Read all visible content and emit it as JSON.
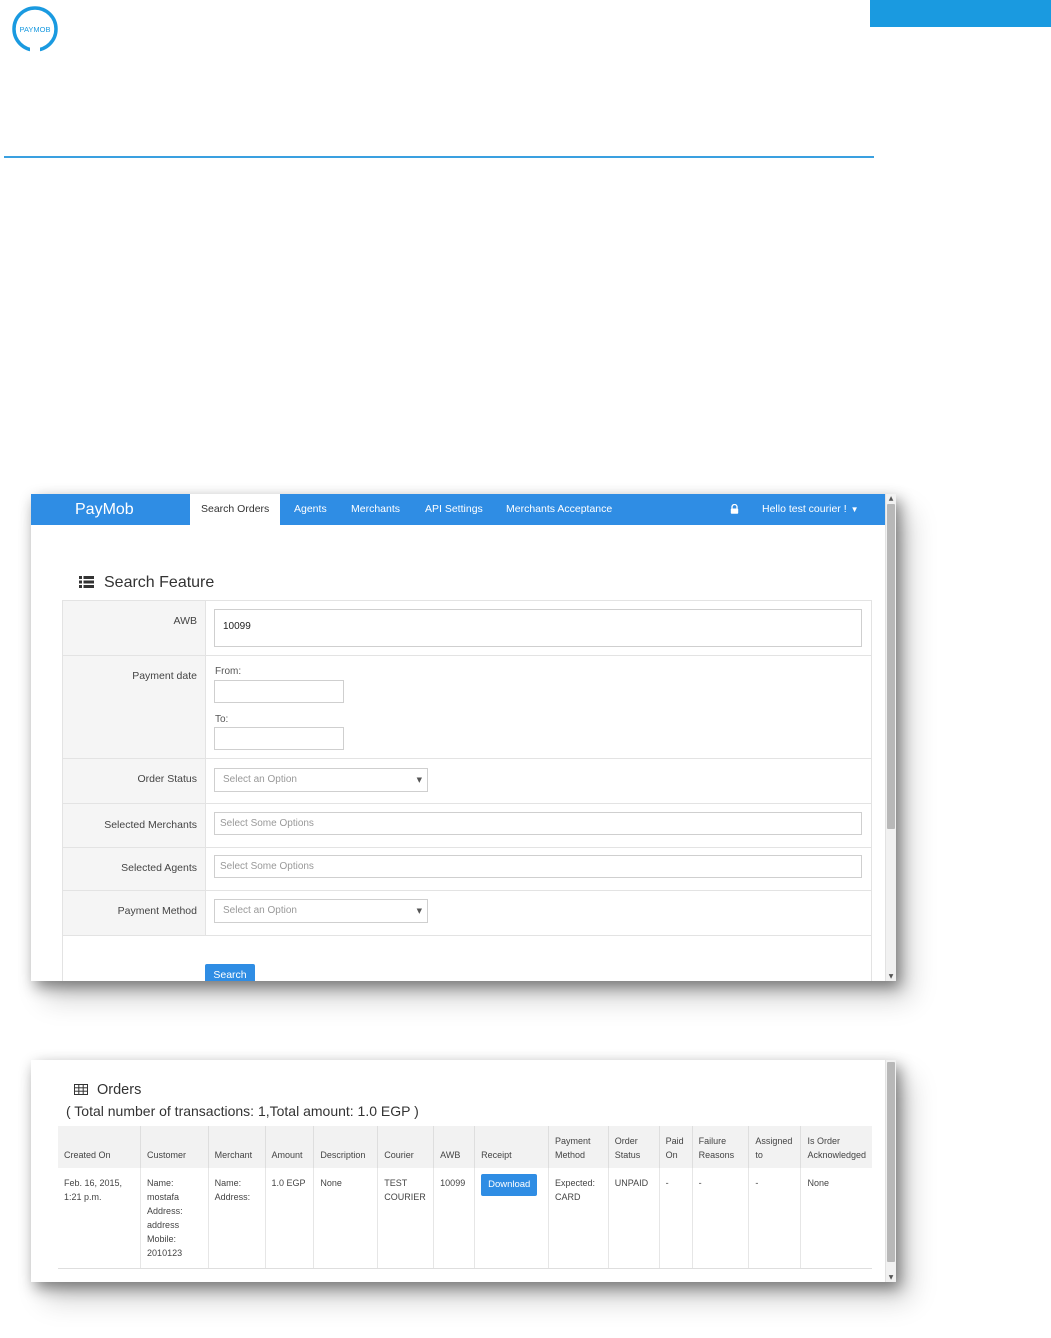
{
  "document": {
    "logo_text": "PAYMOB",
    "colors": {
      "accent": "#1a9ae0"
    }
  },
  "navbar": {
    "brand": "PayMob",
    "items": [
      {
        "label": "Search Orders",
        "active": true
      },
      {
        "label": "Agents"
      },
      {
        "label": "Merchants"
      },
      {
        "label": "API Settings"
      },
      {
        "label": "Merchants Acceptance"
      }
    ],
    "user_label": "Hello test courier !",
    "colors": {
      "background": "#2f8de4"
    }
  },
  "search": {
    "title": "Search Feature",
    "awb": {
      "label": "AWB",
      "value": "10099"
    },
    "payment_date": {
      "label": "Payment date",
      "from_label": "From:",
      "to_label": "To:",
      "from_value": "",
      "to_value": ""
    },
    "order_status": {
      "label": "Order Status",
      "placeholder": "Select an Option"
    },
    "selected_merchants": {
      "label": "Selected Merchants",
      "placeholder": "Select Some Options"
    },
    "selected_agents": {
      "label": "Selected Agents",
      "placeholder": "Select Some Options"
    },
    "payment_method": {
      "label": "Payment Method",
      "placeholder": "Select an Option"
    },
    "submit_label": "Search"
  },
  "orders": {
    "title": "Orders",
    "summary": "( Total number of transactions: 1,Total amount: 1.0 EGP )",
    "columns": [
      [
        "Created On"
      ],
      [
        "Customer"
      ],
      [
        "Merchant"
      ],
      [
        "Amount"
      ],
      [
        "Description"
      ],
      [
        "Courier"
      ],
      [
        "AWB"
      ],
      [
        "Receipt"
      ],
      [
        "Payment",
        "Method"
      ],
      [
        "Order",
        "Status"
      ],
      [
        "Paid",
        "On"
      ],
      [
        "Failure",
        "Reasons"
      ],
      [
        "Assigned",
        "to"
      ],
      [
        "Is Order",
        "Acknowledged"
      ]
    ],
    "rows": [
      {
        "created_on": [
          "Feb. 16, 2015,",
          "1:21 p.m."
        ],
        "customer": [
          "Name:",
          "mostafa",
          "Address:",
          "address",
          "Mobile:",
          "2010123"
        ],
        "merchant": [
          "Name:",
          "Address:"
        ],
        "amount": "1.0 EGP",
        "description": "None",
        "courier": [
          "TEST",
          "COURIER"
        ],
        "awb": "10099",
        "receipt_button": "Download",
        "payment_method": [
          "Expected:",
          "CARD"
        ],
        "order_status": "UNPAID",
        "paid_on": "-",
        "failure_reasons": "-",
        "assigned_to": "-",
        "acknowledged": "None"
      }
    ]
  }
}
